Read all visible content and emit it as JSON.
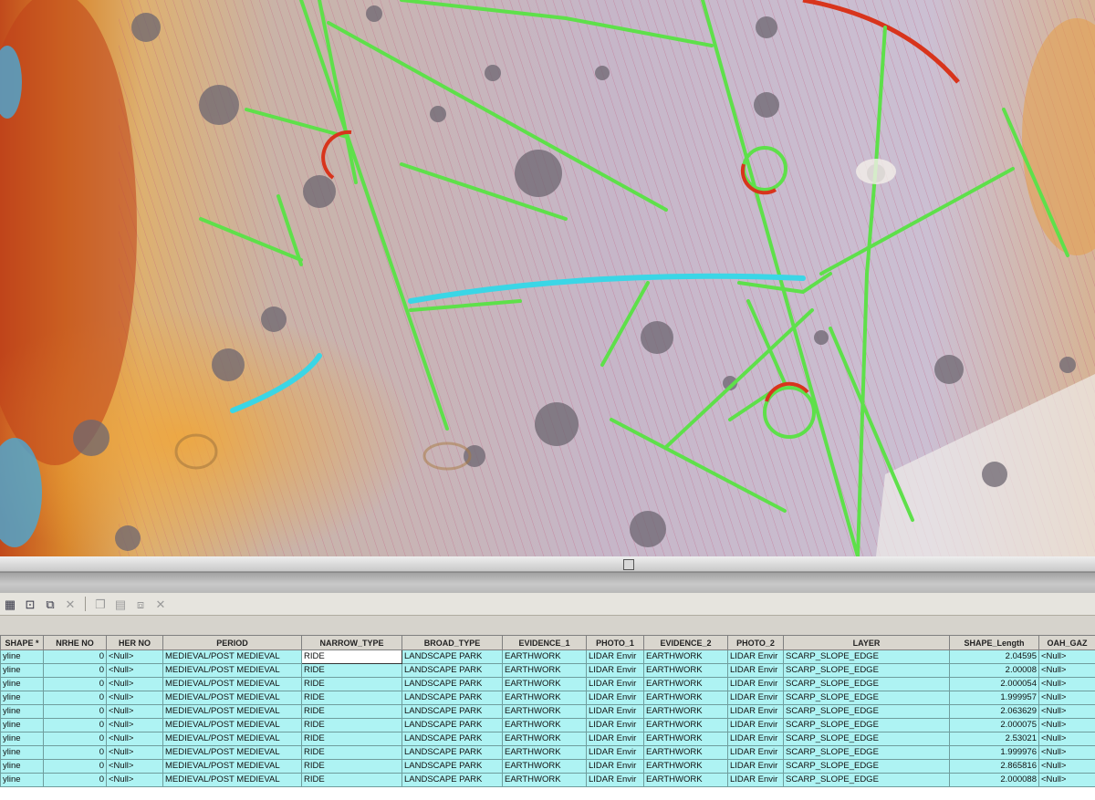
{
  "columns": [
    "SHAPE *",
    "NRHE NO",
    "HER NO",
    "PERIOD",
    "NARROW_TYPE",
    "BROAD_TYPE",
    "EVIDENCE_1",
    "PHOTO_1",
    "EVIDENCE_2",
    "PHOTO_2",
    "LAYER",
    "SHAPE_Length",
    "OAH_GAZ"
  ],
  "rows": [
    [
      "yline",
      "0",
      "<Null>",
      "MEDIEVAL/POST MEDIEVAL",
      "RIDE",
      "LANDSCAPE PARK",
      "EARTHWORK",
      "LIDAR Envir",
      "EARTHWORK",
      "LIDAR Envir",
      "SCARP_SLOPE_EDGE",
      "2.04595",
      "<Null>"
    ],
    [
      "yline",
      "0",
      "<Null>",
      "MEDIEVAL/POST MEDIEVAL",
      "RIDE",
      "LANDSCAPE PARK",
      "EARTHWORK",
      "LIDAR Envir",
      "EARTHWORK",
      "LIDAR Envir",
      "SCARP_SLOPE_EDGE",
      "2.00008",
      "<Null>"
    ],
    [
      "yline",
      "0",
      "<Null>",
      "MEDIEVAL/POST MEDIEVAL",
      "RIDE",
      "LANDSCAPE PARK",
      "EARTHWORK",
      "LIDAR Envir",
      "EARTHWORK",
      "LIDAR Envir",
      "SCARP_SLOPE_EDGE",
      "2.000054",
      "<Null>"
    ],
    [
      "yline",
      "0",
      "<Null>",
      "MEDIEVAL/POST MEDIEVAL",
      "RIDE",
      "LANDSCAPE PARK",
      "EARTHWORK",
      "LIDAR Envir",
      "EARTHWORK",
      "LIDAR Envir",
      "SCARP_SLOPE_EDGE",
      "1.999957",
      "<Null>"
    ],
    [
      "yline",
      "0",
      "<Null>",
      "MEDIEVAL/POST MEDIEVAL",
      "RIDE",
      "LANDSCAPE PARK",
      "EARTHWORK",
      "LIDAR Envir",
      "EARTHWORK",
      "LIDAR Envir",
      "SCARP_SLOPE_EDGE",
      "2.063629",
      "<Null>"
    ],
    [
      "yline",
      "0",
      "<Null>",
      "MEDIEVAL/POST MEDIEVAL",
      "RIDE",
      "LANDSCAPE PARK",
      "EARTHWORK",
      "LIDAR Envir",
      "EARTHWORK",
      "LIDAR Envir",
      "SCARP_SLOPE_EDGE",
      "2.000075",
      "<Null>"
    ],
    [
      "yline",
      "0",
      "<Null>",
      "MEDIEVAL/POST MEDIEVAL",
      "RIDE",
      "LANDSCAPE PARK",
      "EARTHWORK",
      "LIDAR Envir",
      "EARTHWORK",
      "LIDAR Envir",
      "SCARP_SLOPE_EDGE",
      "2.53021",
      "<Null>"
    ],
    [
      "yline",
      "0",
      "<Null>",
      "MEDIEVAL/POST MEDIEVAL",
      "RIDE",
      "LANDSCAPE PARK",
      "EARTHWORK",
      "LIDAR Envir",
      "EARTHWORK",
      "LIDAR Envir",
      "SCARP_SLOPE_EDGE",
      "1.999976",
      "<Null>"
    ],
    [
      "yline",
      "0",
      "<Null>",
      "MEDIEVAL/POST MEDIEVAL",
      "RIDE",
      "LANDSCAPE PARK",
      "EARTHWORK",
      "LIDAR Envir",
      "EARTHWORK",
      "LIDAR Envir",
      "SCARP_SLOPE_EDGE",
      "2.865816",
      "<Null>"
    ],
    [
      "yline",
      "0",
      "<Null>",
      "MEDIEVAL/POST MEDIEVAL",
      "RIDE",
      "LANDSCAPE PARK",
      "EARTHWORK",
      "LIDAR Envir",
      "EARTHWORK",
      "LIDAR Envir",
      "SCARP_SLOPE_EDGE",
      "2.000088",
      "<Null>"
    ]
  ],
  "selected_cell": {
    "row": 0,
    "col": 4
  },
  "numeric_columns": [
    1,
    11
  ],
  "toolbar_icons": [
    "select-all-icon",
    "switch-selection-icon",
    "zoom-to-selected-icon",
    "delete-selected-icon",
    "copy-icon",
    "paste-icon",
    "field-calculator-icon",
    "clear-icon"
  ],
  "colors": {
    "row_background": "#aef3f3",
    "header_background": "#d9d6ce",
    "feature_line": "#5ee04a",
    "highlight_line": "#3ad6e6",
    "scarp_line": "#d8341c"
  }
}
